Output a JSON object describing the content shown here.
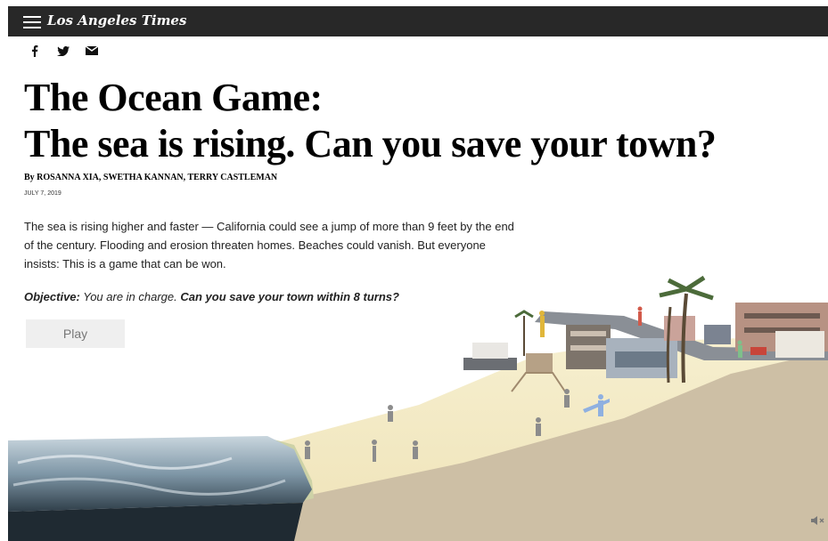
{
  "header": {
    "brand": "Los Angeles Times",
    "menu_icon": "hamburger-icon"
  },
  "share": {
    "icons": [
      "facebook-icon",
      "twitter-icon",
      "email-icon"
    ]
  },
  "article": {
    "title_line1": "The Ocean Game:",
    "title_line2": "The sea is rising. Can you save your town?",
    "byline": "By ROSANNA XIA, SWETHA KANNAN, TERRY CASTLEMAN",
    "date": "JULY 7, 2019",
    "intro": "The sea is rising higher and faster — California could see a jump of more than 9 feet by the end of the century. Flooding and erosion threaten homes. Beaches could vanish. But everyone insists: This is a game that can be won.",
    "objective_label": "Objective:",
    "objective_text": " You are in charge. ",
    "objective_question": "Can you save your town within 8 turns?",
    "play_label": "Play"
  },
  "colors": {
    "topbar": "#282828",
    "sand": "#f3e9c2",
    "ground": "#cfc2a8",
    "ocean": "#8fa6b5"
  },
  "controls": {
    "mute_icon": "mute-icon"
  }
}
